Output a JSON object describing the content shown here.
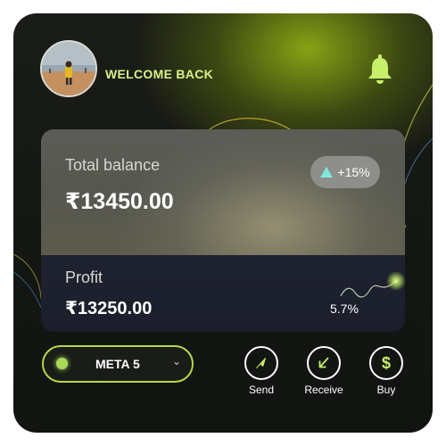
{
  "header": {
    "greeting": "WELCOME BACK",
    "avatar_icon": "user-avatar",
    "notification_icon": "bell-icon"
  },
  "balance_card": {
    "label": "Total balance",
    "amount": "₹13450.00",
    "change": "+15%",
    "change_icon": "triangle-up-icon"
  },
  "profit_card": {
    "label": "Profit",
    "amount": "₹13250.00",
    "percent": "5.7%"
  },
  "account_selector": {
    "selected": "META 5",
    "status_color": "#a9d85a"
  },
  "actions": [
    {
      "label": "Send",
      "icon": "send-icon"
    },
    {
      "label": "Receive",
      "icon": "receive-icon"
    },
    {
      "label": "Buy",
      "icon": "dollar-icon"
    }
  ],
  "colors": {
    "accent": "#d9f28a",
    "bell": "#c8ef6a",
    "badge_arrow": "#7fe6e0"
  }
}
